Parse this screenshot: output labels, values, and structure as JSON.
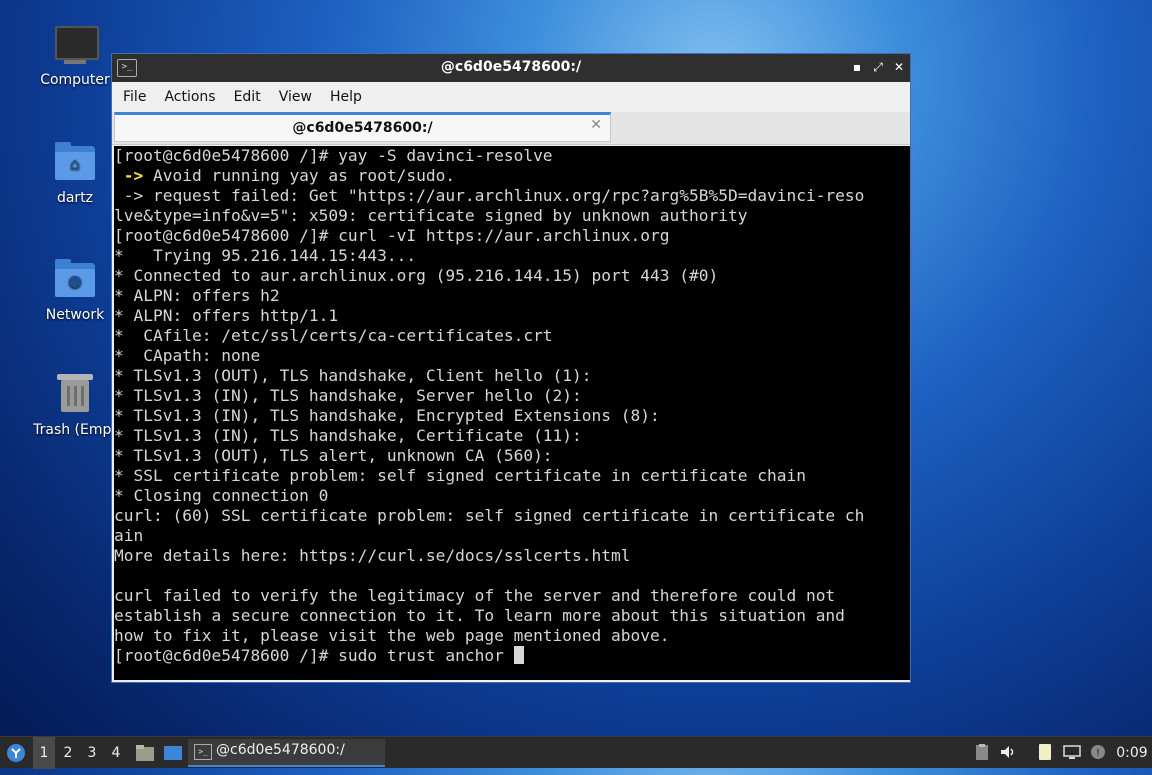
{
  "desktop": {
    "icons": [
      {
        "label": "Computer"
      },
      {
        "label": "dartz"
      },
      {
        "label": "Network"
      },
      {
        "label": "Trash (Empt"
      }
    ]
  },
  "window": {
    "title": "@c6d0e5478600:/",
    "buttons": {
      "minimize": "▪",
      "maximize": "⤢",
      "close": "✕"
    },
    "menu": [
      "File",
      "Actions",
      "Edit",
      "View",
      "Help"
    ],
    "tab": {
      "label": "@c6d0e5478600:/",
      "close": "✕"
    }
  },
  "terminal": {
    "lines": [
      "[root@c6d0e5478600 /]# yay -S davinci-resolve",
      "Avoid running yay as root/sudo.",
      " -> request failed: Get \"https://aur.archlinux.org/rpc?arg%5B%5D=davinci-reso",
      "lve&type=info&v=5\": x509: certificate signed by unknown authority",
      "[root@c6d0e5478600 /]# curl -vI https://aur.archlinux.org",
      "*   Trying 95.216.144.15:443...",
      "* Connected to aur.archlinux.org (95.216.144.15) port 443 (#0)",
      "* ALPN: offers h2",
      "* ALPN: offers http/1.1",
      "*  CAfile: /etc/ssl/certs/ca-certificates.crt",
      "*  CApath: none",
      "* TLSv1.3 (OUT), TLS handshake, Client hello (1):",
      "* TLSv1.3 (IN), TLS handshake, Server hello (2):",
      "* TLSv1.3 (IN), TLS handshake, Encrypted Extensions (8):",
      "* TLSv1.3 (IN), TLS handshake, Certificate (11):",
      "* TLSv1.3 (OUT), TLS alert, unknown CA (560):",
      "* SSL certificate problem: self signed certificate in certificate chain",
      "* Closing connection 0",
      "curl: (60) SSL certificate problem: self signed certificate in certificate ch",
      "ain",
      "More details here: https://curl.se/docs/sslcerts.html",
      "",
      "curl failed to verify the legitimacy of the server and therefore could not",
      "establish a secure connection to it. To learn more about this situation and",
      "how to fix it, please visit the web page mentioned above.",
      "[root@c6d0e5478600 /]# sudo trust anchor "
    ],
    "warn_arrow": " ->"
  },
  "taskbar": {
    "workspaces": [
      "1",
      "2",
      "3",
      "4"
    ],
    "active_workspace": "1",
    "task_label": "@c6d0e5478600:/",
    "clock": "0:09"
  },
  "colors": {
    "accent": "#3d85d8",
    "terminal_bg": "#000000",
    "terminal_fg": "#d6d6d6",
    "warning_arrow": "#f5e243"
  }
}
